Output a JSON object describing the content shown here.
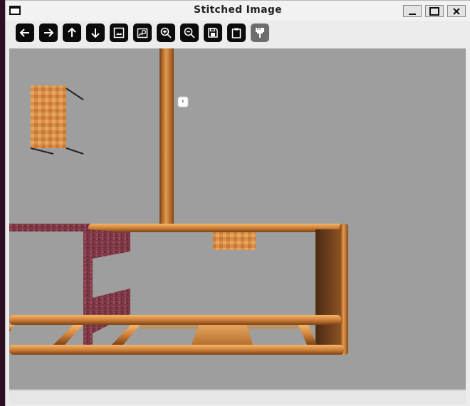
{
  "window": {
    "title": "Stitched Image",
    "controls": {
      "minimize": "_",
      "maximize": "□",
      "close": "✕"
    }
  },
  "toolbar": {
    "buttons": [
      {
        "name": "back-button",
        "icon": "arrow-left-icon"
      },
      {
        "name": "forward-button",
        "icon": "arrow-right-icon"
      },
      {
        "name": "up-button",
        "icon": "arrow-up-icon"
      },
      {
        "name": "down-button",
        "icon": "arrow-down-icon"
      },
      {
        "name": "image-button",
        "icon": "image-icon"
      },
      {
        "name": "image-search-button",
        "icon": "image-search-icon"
      },
      {
        "name": "zoom-in-button",
        "icon": "zoom-in-icon"
      },
      {
        "name": "zoom-out-button",
        "icon": "zoom-out-icon"
      },
      {
        "name": "save-button",
        "icon": "save-icon"
      },
      {
        "name": "clipboard-button",
        "icon": "clipboard-icon"
      },
      {
        "name": "paint-brush-button",
        "icon": "paint-brush-icon",
        "disabled": true
      }
    ]
  },
  "status": {
    "text": ""
  },
  "colors": {
    "canvas": "#9e9e9e",
    "wood": "#d08538",
    "brick": "#8a3d4a",
    "toolbar_button": "#0b0b0b"
  }
}
